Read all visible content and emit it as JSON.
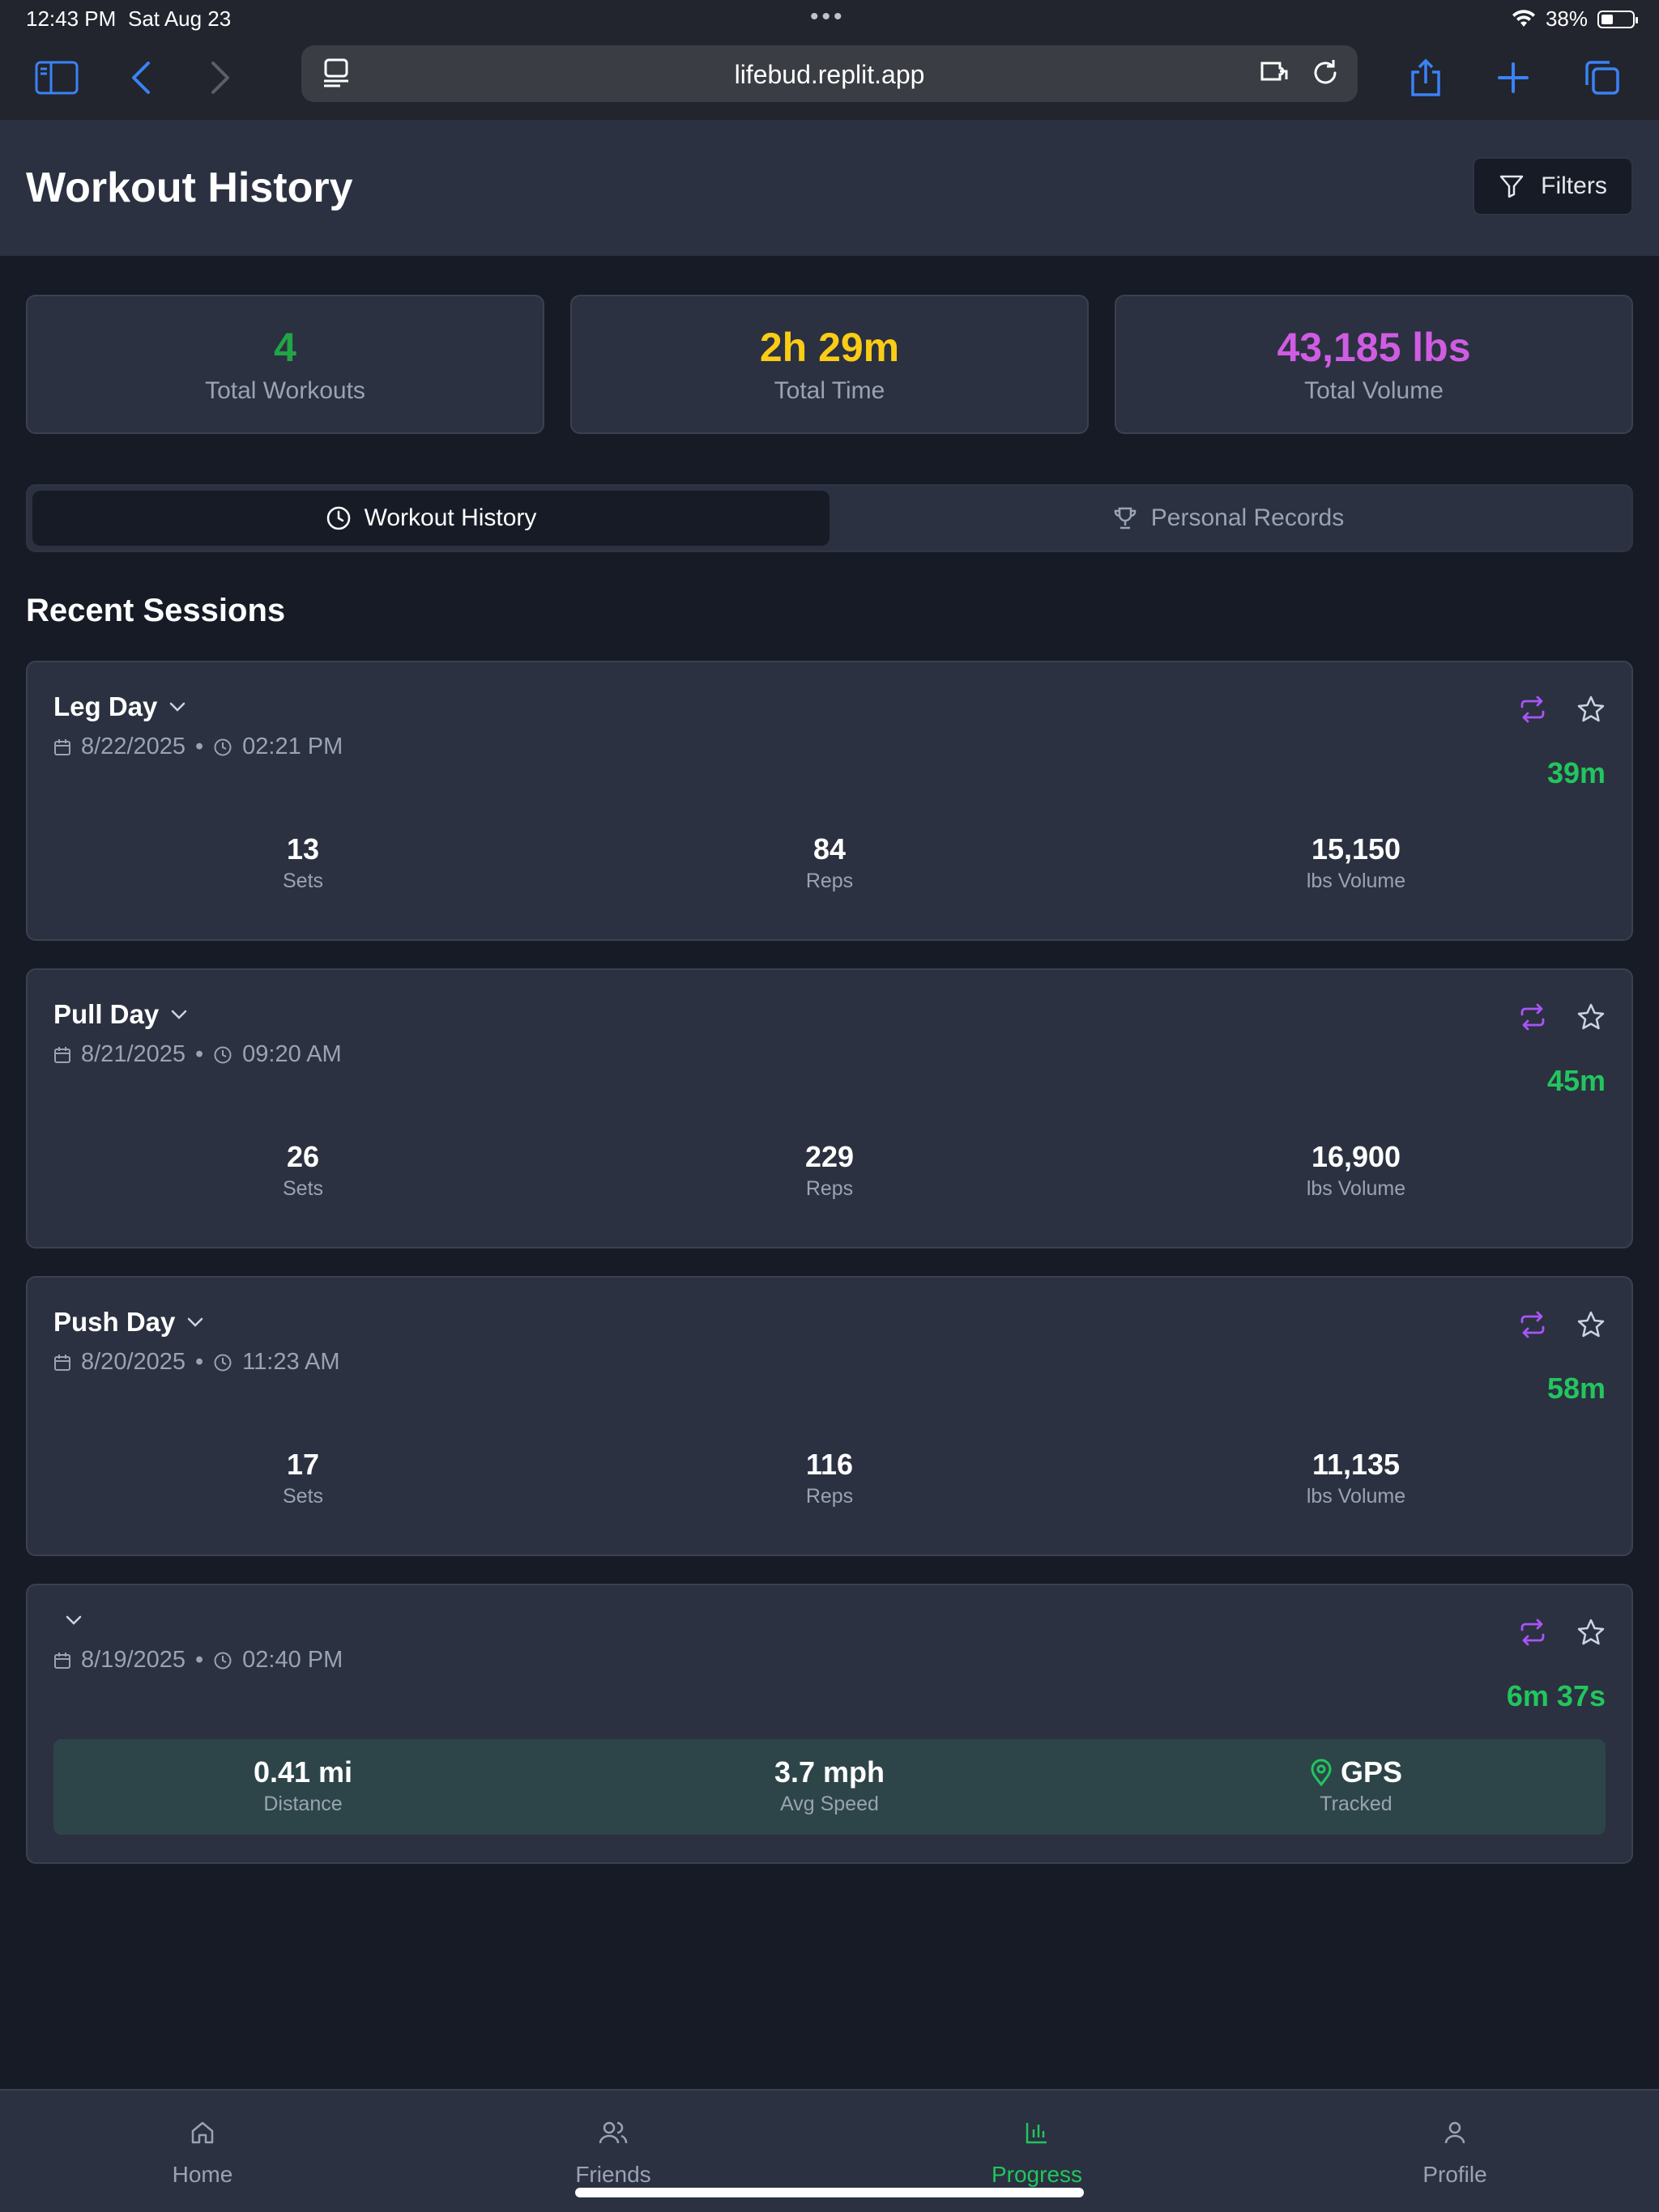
{
  "status_bar": {
    "time": "12:43 PM",
    "date": "Sat Aug 23",
    "battery": "38%",
    "battery_level": 0.38
  },
  "browser": {
    "url": "lifebud.replit.app"
  },
  "header": {
    "title": "Workout History",
    "filters_label": "Filters"
  },
  "stats": [
    {
      "value": "4",
      "label": "Total Workouts",
      "color": "#22a447"
    },
    {
      "value": "2h 29m",
      "label": "Total Time",
      "color": "#facc15"
    },
    {
      "value": "43,185 lbs",
      "label": "Total Volume",
      "color": "#d05ce3"
    }
  ],
  "tabs": [
    {
      "label": "Workout History",
      "icon": "clock-icon",
      "active": true
    },
    {
      "label": "Personal Records",
      "icon": "trophy-icon",
      "active": false
    }
  ],
  "section_title": "Recent Sessions",
  "sessions": [
    {
      "name": "Leg Day",
      "date": "8/22/2025",
      "time": "02:21 PM",
      "duration": "39m",
      "sets": "13",
      "sets_label": "Sets",
      "reps": "84",
      "reps_label": "Reps",
      "volume": "15,150",
      "volume_label": "lbs Volume"
    },
    {
      "name": "Pull Day",
      "date": "8/21/2025",
      "time": "09:20 AM",
      "duration": "45m",
      "sets": "26",
      "sets_label": "Sets",
      "reps": "229",
      "reps_label": "Reps",
      "volume": "16,900",
      "volume_label": "lbs Volume"
    },
    {
      "name": "Push Day",
      "date": "8/20/2025",
      "time": "11:23 AM",
      "duration": "58m",
      "sets": "17",
      "sets_label": "Sets",
      "reps": "116",
      "reps_label": "Reps",
      "volume": "11,135",
      "volume_label": "lbs Volume"
    },
    {
      "name": "",
      "date": "8/19/2025",
      "time": "02:40 PM",
      "duration": "6m 37s",
      "distance": "0.41 mi",
      "distance_label": "Distance",
      "speed": "3.7 mph",
      "speed_label": "Avg Speed",
      "gps": "GPS",
      "gps_label": "Tracked"
    }
  ],
  "meta_separator": "•",
  "nav": [
    {
      "label": "Home",
      "icon": "home-icon",
      "active": false
    },
    {
      "label": "Friends",
      "icon": "users-icon",
      "active": false
    },
    {
      "label": "Progress",
      "icon": "bar-chart-icon",
      "active": true
    },
    {
      "label": "Profile",
      "icon": "user-icon",
      "active": false
    }
  ],
  "colors": {
    "accent_green": "#22c55e",
    "accent_purple": "#a855f7",
    "safari_blue": "#3b82f6"
  }
}
